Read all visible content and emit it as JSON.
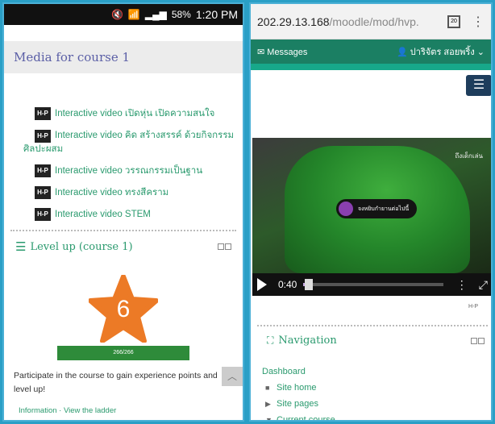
{
  "left": {
    "status": {
      "mute": "🔇",
      "wifi": "📶",
      "signal": "▂▄▆",
      "battery": "58%",
      "time": "1:20 PM"
    },
    "media_title": "Media for course 1",
    "h5p_badge": "H-P",
    "videos": [
      "Interactive video เปิดหุ่น เปิดความสนใจ",
      "Interactive video คิด สร้างสรรค์ ด้วยกิจกรรมศิลปะผสม",
      "Interactive video วรรณกรรมเป็นฐาน",
      "Interactive video ทรงสีคราม",
      "Interactive video STEM"
    ],
    "levelup_title": "Level up (course 1)",
    "level": "6",
    "xp": "266/266",
    "description": "Participate in the course to gain experience points and level up!",
    "footer": "Information · View the ladder",
    "scroll_top": "︿"
  },
  "right": {
    "url_host": "202.29.13.168",
    "url_path": "/moodle/mod/hvp.",
    "tab_count": "20",
    "messages_label": "Messages",
    "user_name": "ปาริจัตร สอยพริ้ง",
    "video": {
      "tag_text": "จงหยิบกำยานต่อไปนี้",
      "brand": "ถึงเด็กเล่น",
      "time": "0:40",
      "progress": 0.04
    },
    "h5p_small": "H-P",
    "navigation_title": "Navigation",
    "nav": {
      "dashboard": "Dashboard",
      "site_home": "Site home",
      "site_pages": "Site pages",
      "current_course": "Current course"
    },
    "icons": [
      "hamburger-icon",
      "user-icon",
      "envelope-icon",
      "play-icon",
      "fullscreen-icon",
      "sitemap-icon"
    ]
  }
}
